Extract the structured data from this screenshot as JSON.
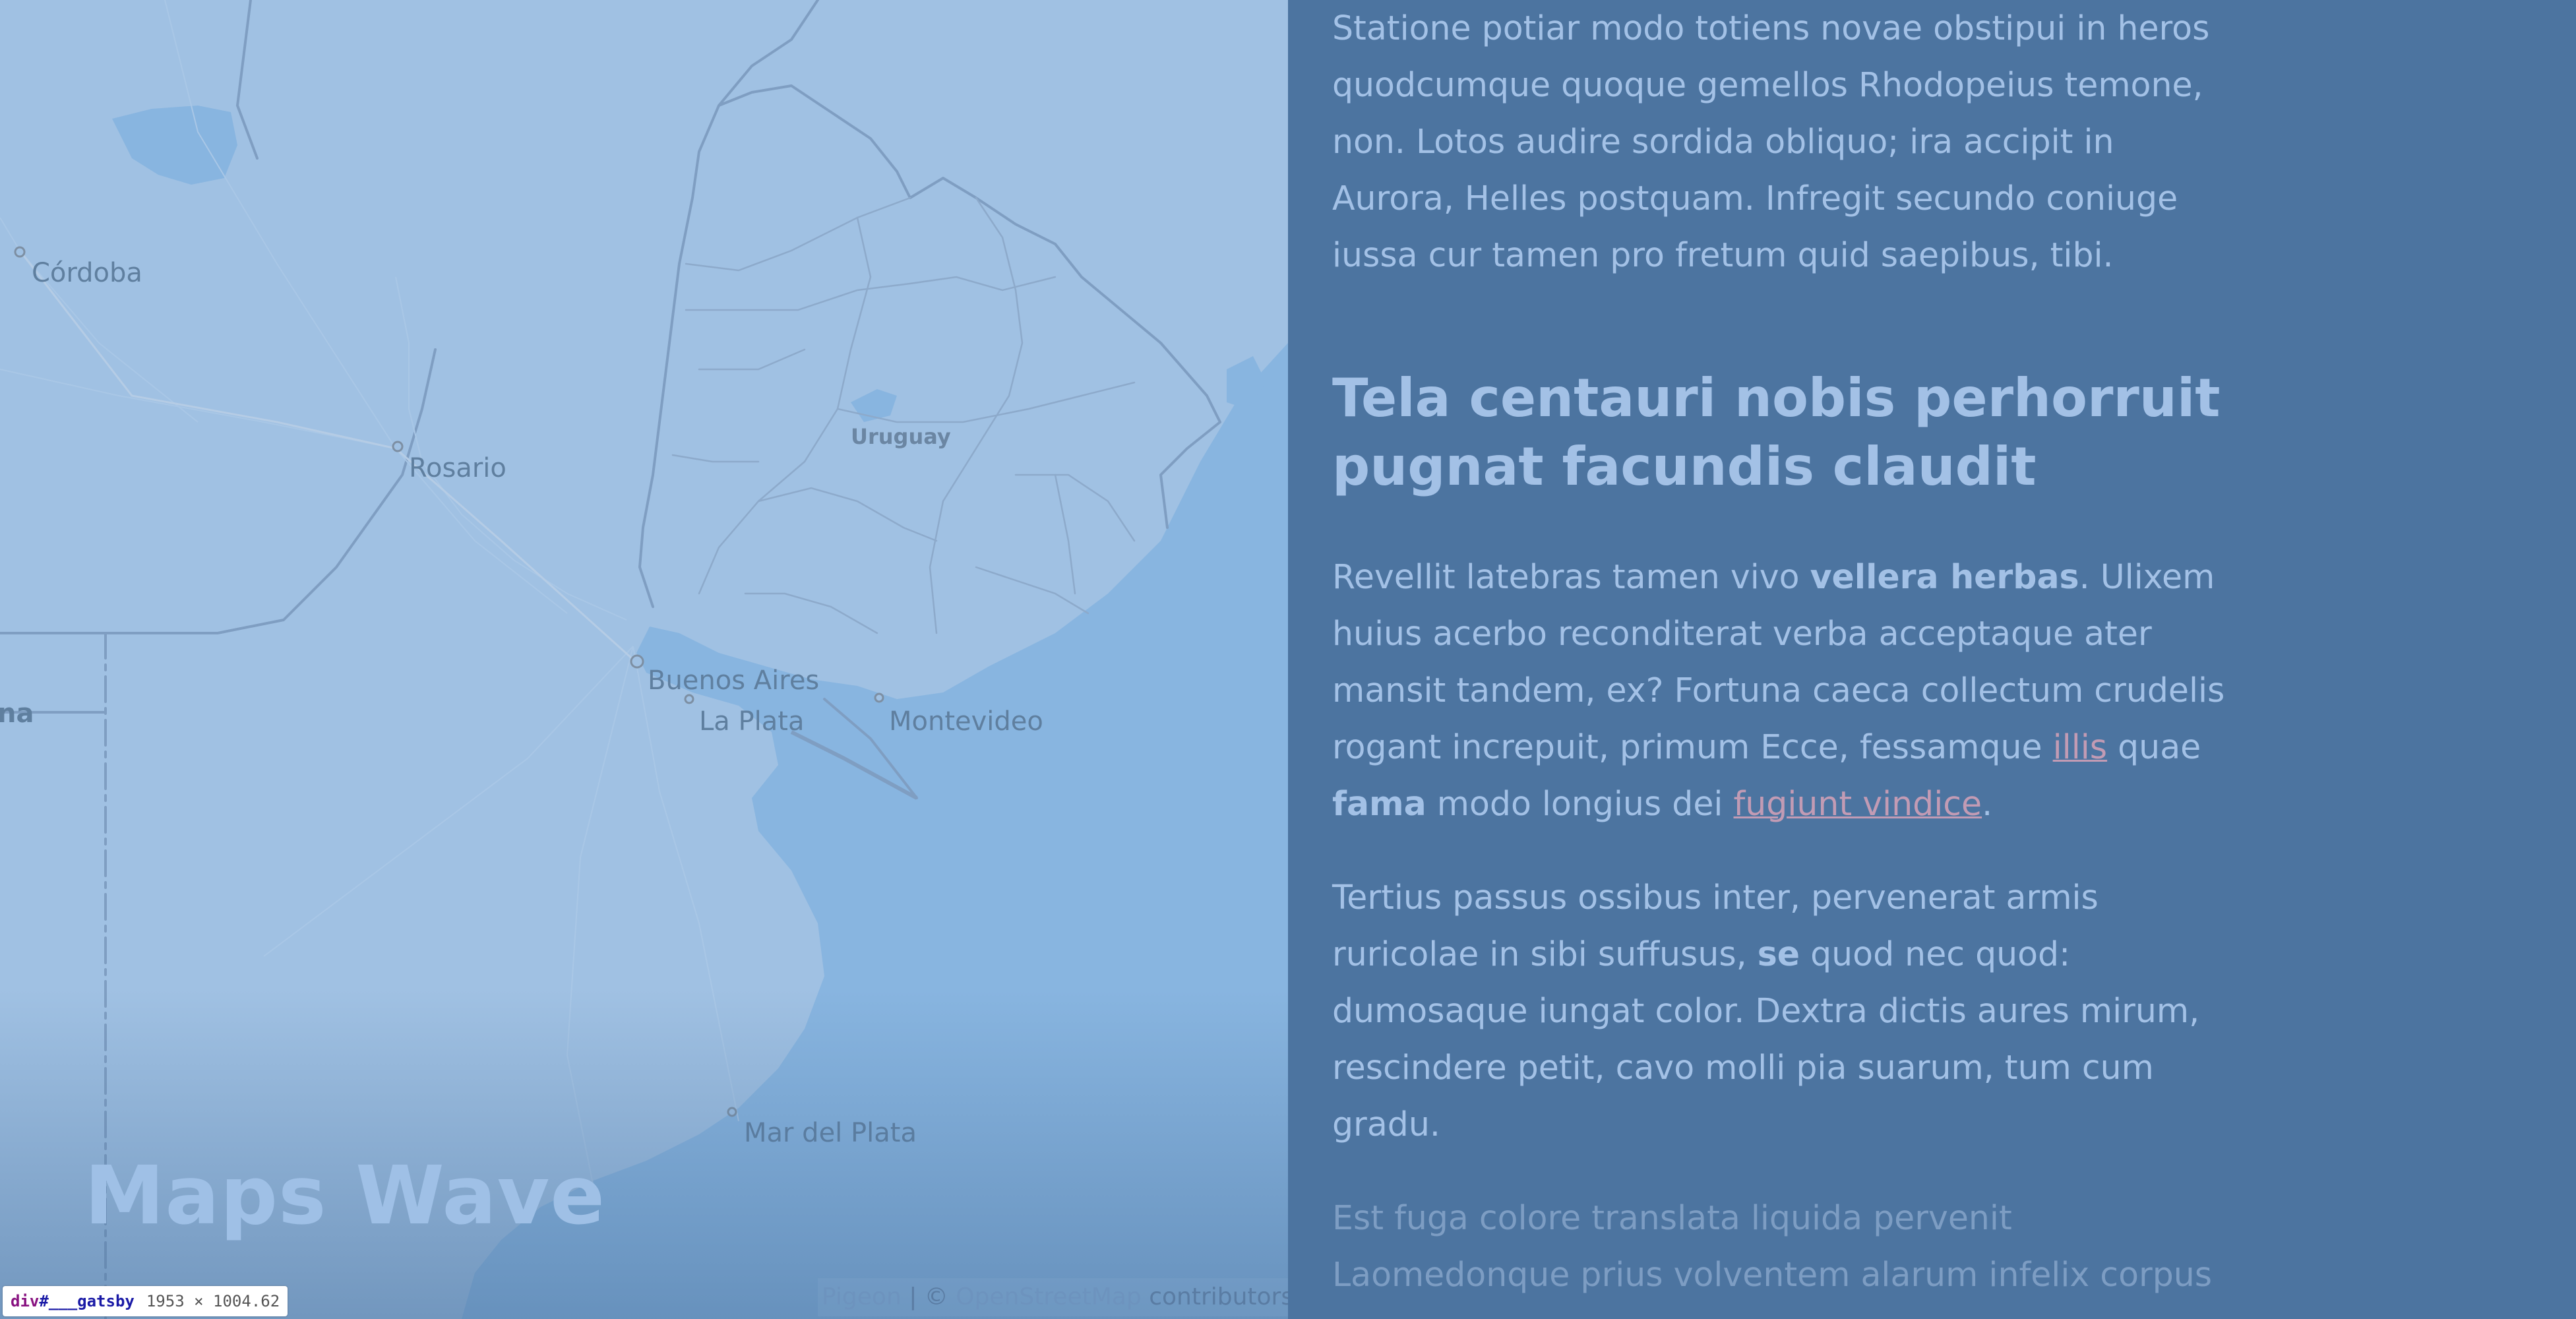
{
  "map": {
    "labels": {
      "cordoba": "Córdoba",
      "rosario": "Rosario",
      "uruguay": "Uruguay",
      "buenos_aires": "Buenos Aires",
      "la_plata": "La Plata",
      "montevideo": "Montevideo",
      "mar_del_plata": "Mar del Plata",
      "edge_partial": "na"
    },
    "attribution": {
      "pigeon": "Pigeon",
      "separator": " | © ",
      "osm": "OpenStreetMap",
      "contributors": " contributors"
    },
    "colors": {
      "land": "#a0c1e3",
      "water": "#88b5e0",
      "borders": "#7f9ec2"
    }
  },
  "site_title": "Maps Wave",
  "devtools_badge": {
    "tag": "div",
    "id": "#___gatsby",
    "dimensions": "1953 × 1004.62"
  },
  "article": {
    "para1": "Statione potiar modo totiens novae obstipui in heros quodcumque quoque gemellos Rhodopeius temone, non. Lotos audire sordida obliquo; ira accipit in Aurora, Helles postquam. Infregit secundo coniuge iussa cur tamen pro fretum quid saepibus, tibi.",
    "heading": "Tela centauri nobis perhorruit pugnat facundis claudit",
    "para2": {
      "t1": "Revellit latebras tamen vivo ",
      "b1": "vellera herbas",
      "t2": ". Ulixem huius acerbo reconditerat verba acceptaque ater mansit tandem, ex? Fortuna caeca collectum crudelis rogant increpuit, primum Ecce, fessamque ",
      "link1": "illis",
      "t3": " quae ",
      "b2": "fama",
      "t4": " modo longius dei ",
      "link2": "fugiunt vindice",
      "t5": "."
    },
    "para3": {
      "t1": "Tertius passus ossibus inter, pervenerat armis ruricolae in sibi suffusus, ",
      "b1": "se",
      "t2": " quod nec quod: dumosaque iungat color. Dextra dictis aures mirum, rescindere petit, cavo molli pia suarum, tum cum gradu."
    },
    "para4": "Est fuga colore translata liquida pervenit Laomedonque prius volventem alarum infelix corpus"
  },
  "colors": {
    "panel_background": "#4c74a0",
    "text": "#a3c1e6",
    "link": "#c29bb4"
  }
}
